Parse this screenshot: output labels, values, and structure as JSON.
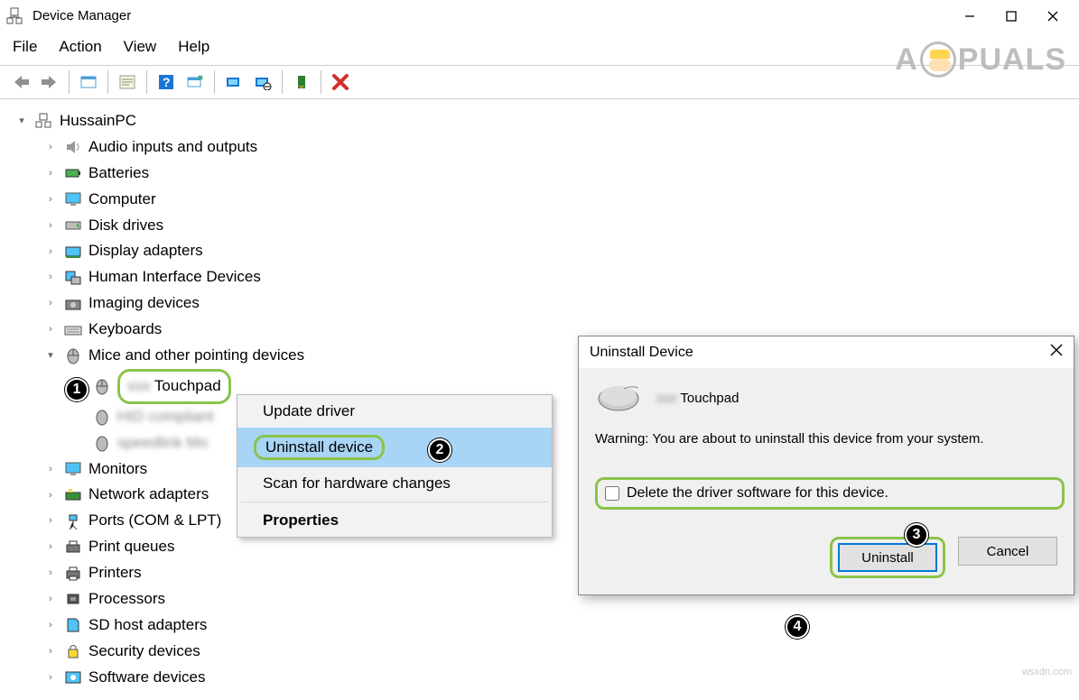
{
  "window": {
    "title": "Device Manager"
  },
  "menu": [
    "File",
    "Action",
    "View",
    "Help"
  ],
  "tree": {
    "root": "HussainPC",
    "items": [
      {
        "label": "Audio inputs and outputs"
      },
      {
        "label": "Batteries"
      },
      {
        "label": "Computer"
      },
      {
        "label": "Disk drives"
      },
      {
        "label": "Display adapters"
      },
      {
        "label": "Human Interface Devices"
      },
      {
        "label": "Imaging devices"
      },
      {
        "label": "Keyboards"
      },
      {
        "label": "Mice and other pointing devices",
        "expanded": true
      },
      {
        "label": "Monitors"
      },
      {
        "label": "Network adapters"
      },
      {
        "label": "Ports (COM & LPT)"
      },
      {
        "label": "Print queues"
      },
      {
        "label": "Printers"
      },
      {
        "label": "Processors"
      },
      {
        "label": "SD host adapters"
      },
      {
        "label": "Security devices"
      },
      {
        "label": "Software devices"
      }
    ],
    "mice_children": [
      {
        "label": "Touchpad",
        "highlighted": true
      }
    ]
  },
  "context_menu": {
    "update": "Update driver",
    "uninstall": "Uninstall device",
    "scan": "Scan for hardware changes",
    "properties": "Properties"
  },
  "dialog": {
    "title": "Uninstall Device",
    "device": "Touchpad",
    "warning": "Warning: You are about to uninstall this device from your system.",
    "checkbox": "Delete the driver software for this device.",
    "ok": "Uninstall",
    "cancel": "Cancel"
  },
  "watermark": {
    "pre": "A",
    "post": "PUALS"
  },
  "callouts": [
    "1",
    "2",
    "3",
    "4"
  ],
  "source_url": "wsxdn.com"
}
